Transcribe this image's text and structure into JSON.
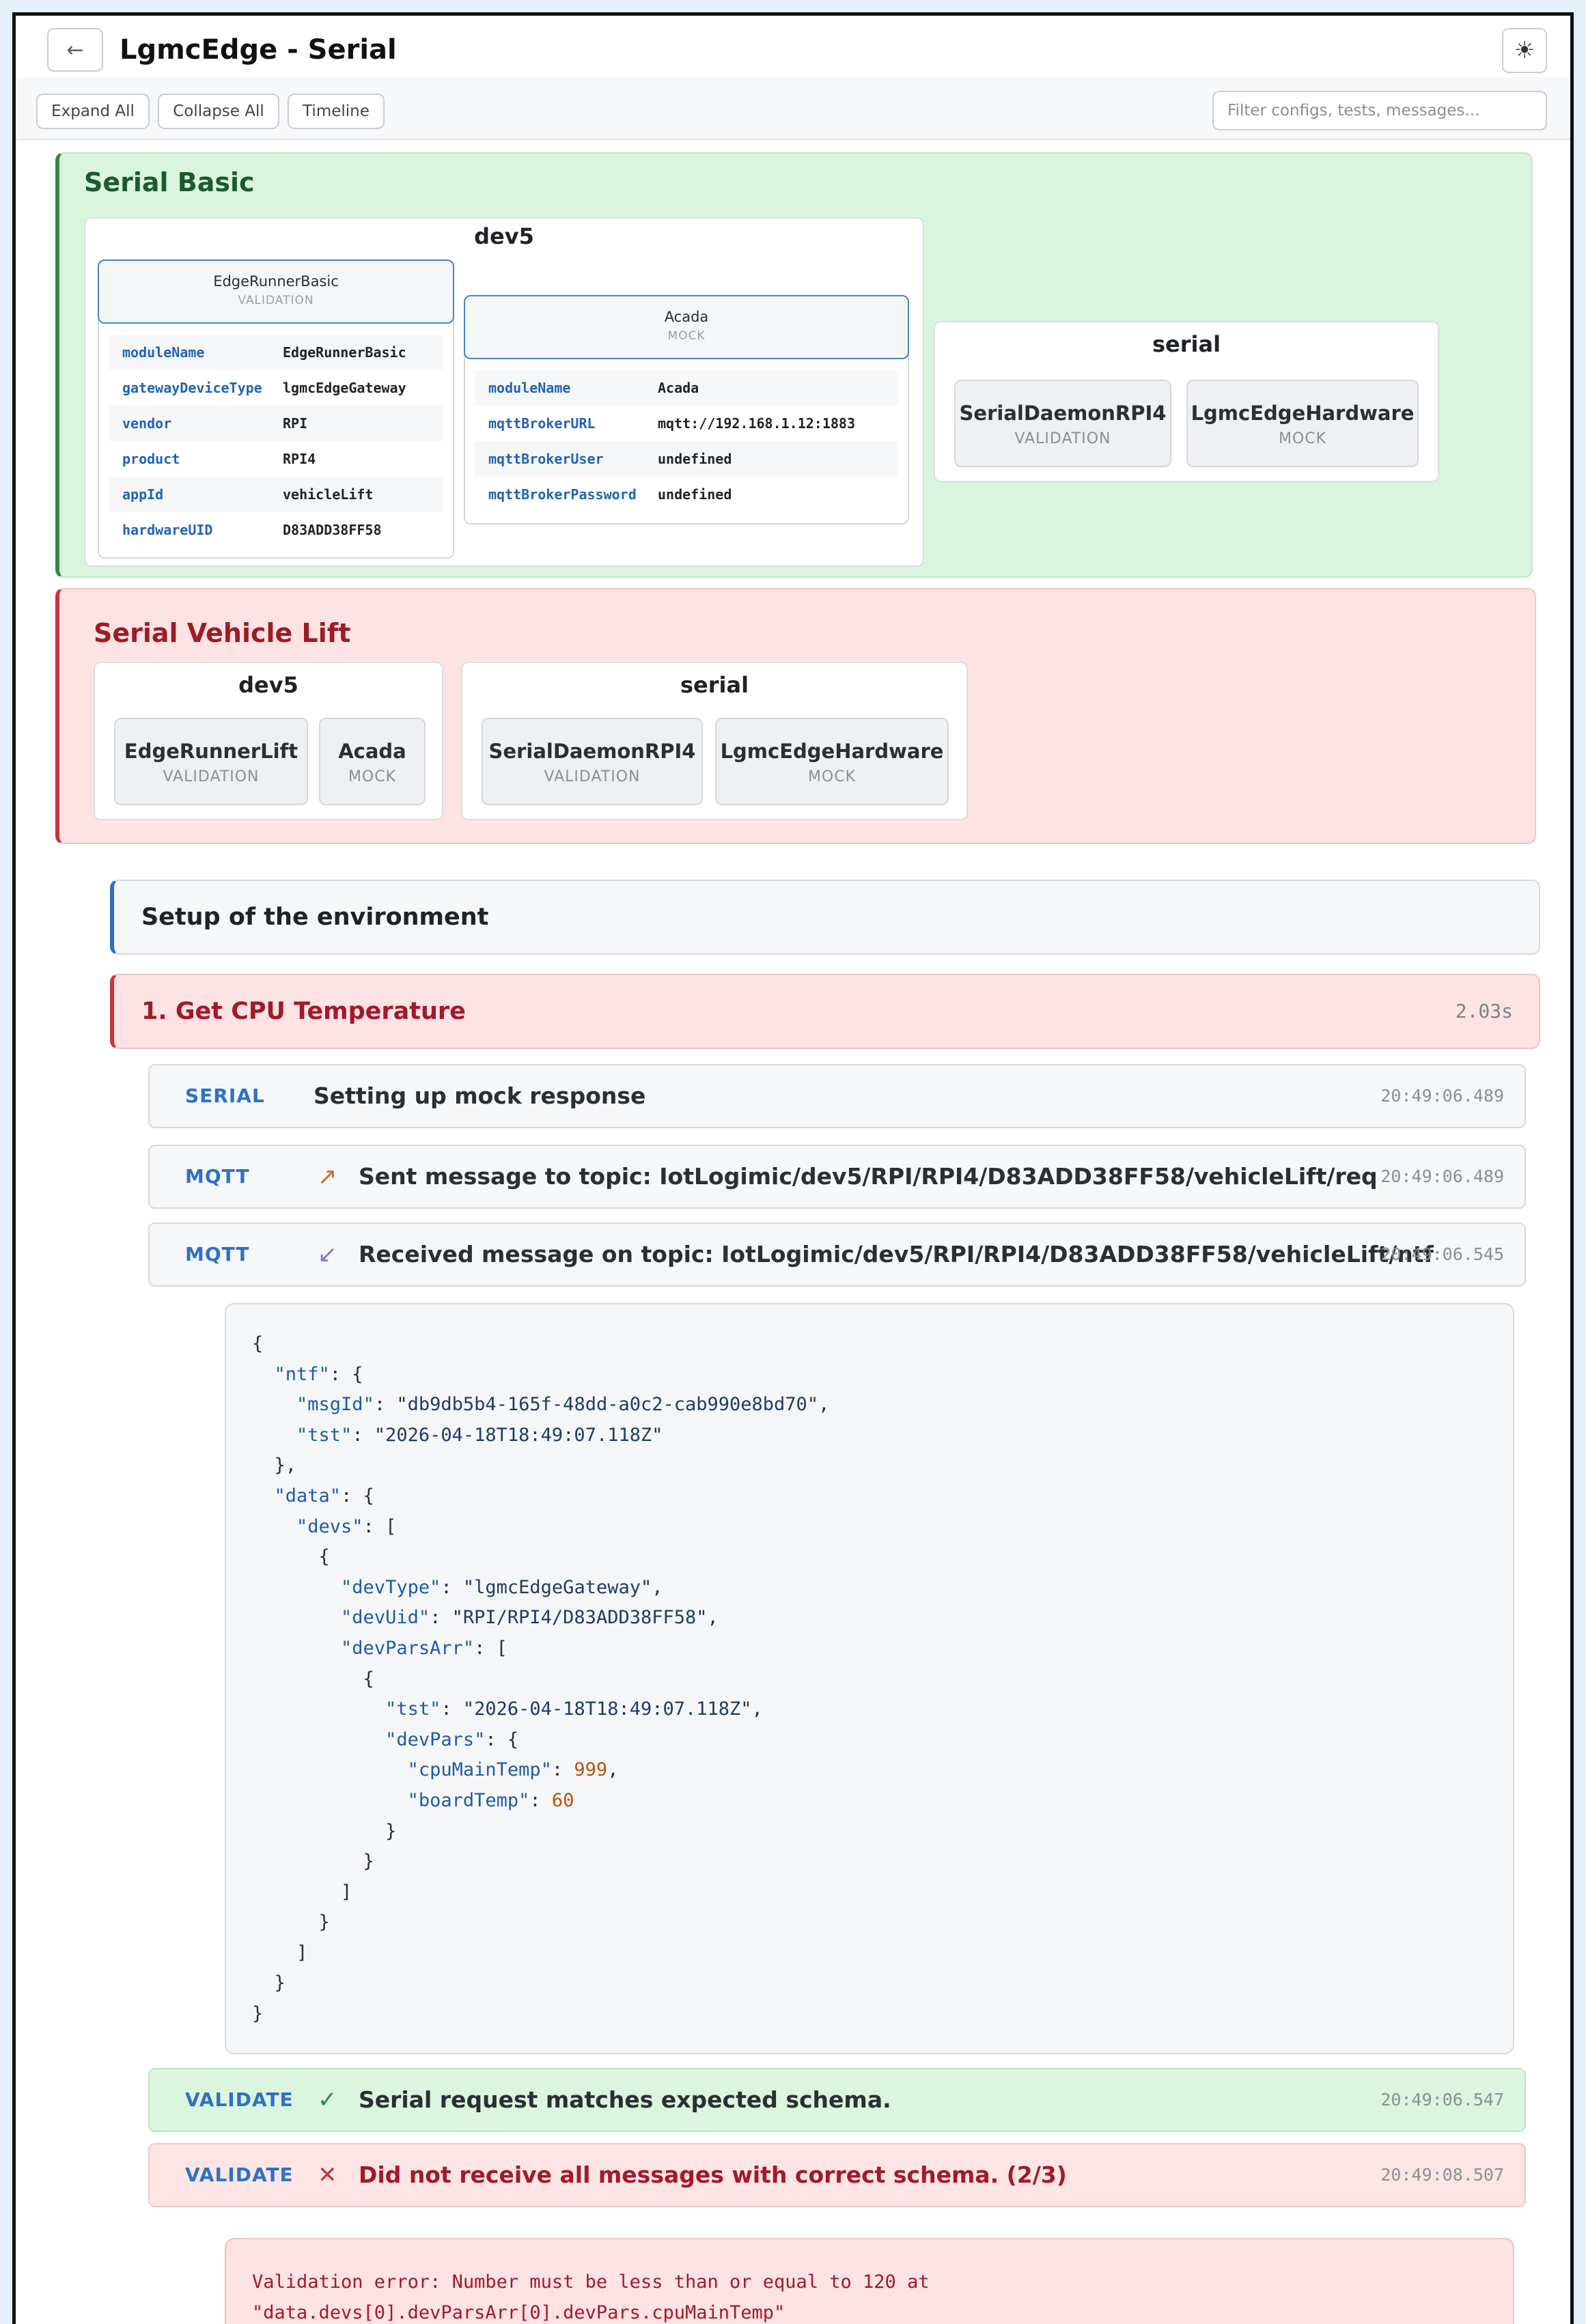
{
  "header": {
    "title": "LgmcEdge - Serial",
    "back_icon": "←",
    "theme_icon": "☀"
  },
  "toolbar": {
    "expand_all": "Expand All",
    "collapse_all": "Collapse All",
    "timeline": "Timeline",
    "filter_placeholder": "Filter configs, tests, messages..."
  },
  "serial_basic": {
    "title": "Serial Basic",
    "dev5": {
      "label": "dev5",
      "configs": [
        {
          "name": "EdgeRunnerBasic",
          "type": "VALIDATION",
          "rows": [
            {
              "key": "moduleName",
              "value": "EdgeRunnerBasic"
            },
            {
              "key": "gatewayDeviceType",
              "value": "lgmcEdgeGateway"
            },
            {
              "key": "vendor",
              "value": "RPI"
            },
            {
              "key": "product",
              "value": "RPI4"
            },
            {
              "key": "appId",
              "value": "vehicleLift"
            },
            {
              "key": "hardwareUID",
              "value": "D83ADD38FF58"
            }
          ]
        },
        {
          "name": "Acada",
          "type": "MOCK",
          "rows": [
            {
              "key": "moduleName",
              "value": "Acada"
            },
            {
              "key": "mqttBrokerURL",
              "value": "mqtt://192.168.1.12:1883"
            },
            {
              "key": "mqttBrokerUser",
              "value": "undefined"
            },
            {
              "key": "mqttBrokerPassword",
              "value": "undefined"
            }
          ]
        }
      ]
    },
    "serial": {
      "label": "serial",
      "modules": [
        {
          "name": "SerialDaemonRPI4",
          "type": "VALIDATION"
        },
        {
          "name": "LgmcEdgeHardware",
          "type": "MOCK"
        }
      ]
    }
  },
  "serial_vehicle_lift": {
    "title": "Serial Vehicle Lift",
    "dev5": {
      "label": "dev5",
      "modules": [
        {
          "name": "EdgeRunnerLift",
          "type": "VALIDATION"
        },
        {
          "name": "Acada",
          "type": "MOCK"
        }
      ]
    },
    "serial": {
      "label": "serial",
      "modules": [
        {
          "name": "SerialDaemonRPI4",
          "type": "VALIDATION"
        },
        {
          "name": "LgmcEdgeHardware",
          "type": "MOCK"
        }
      ]
    }
  },
  "tests": {
    "setup": "Setup of the environment",
    "test1": {
      "title": "1. Get CPU Temperature",
      "duration": "2.03s",
      "steps": [
        {
          "tag": "SERIAL",
          "icon": "",
          "text": "Setting up mock response",
          "time": "20:49:06.489"
        },
        {
          "tag": "MQTT",
          "icon": "↗",
          "text": "Sent message to topic: IotLogimic/dev5/RPI/RPI4/D83ADD38FF58/vehicleLift/req",
          "time": "20:49:06.489"
        },
        {
          "tag": "MQTT",
          "icon": "↙",
          "text": "Received message on topic: IotLogimic/dev5/RPI/RPI4/D83ADD38FF58/vehicleLift/ntf",
          "time": "20:49:06.545"
        },
        {
          "tag": "VALIDATE",
          "icon": "✓",
          "text": "Serial request matches expected schema.",
          "time": "20:49:06.547"
        },
        {
          "tag": "VALIDATE",
          "icon": "✕",
          "text": "Did not receive all messages with correct schema. (2/3)",
          "time": "20:49:08.507"
        }
      ],
      "payload": {
        "msgId": "db9db5b4-165f-48dd-a0c2-cab990e8bd70",
        "ntf_tst": "2026-04-18T18:49:07.118Z",
        "devType": "lgmcEdgeGateway",
        "devUid": "RPI/RPI4/D83ADD38FF58",
        "pars_tst": "2026-04-18T18:49:07.118Z",
        "cpuMainTemp": 999,
        "boardTemp": 60
      },
      "error": "Validation error: Number must be less than or equal to 120 at\n\"data.devs[0].devParsArr[0].devPars.cpuMainTemp\""
    }
  },
  "colors": {
    "green_accent": "#2f8a45",
    "red_accent": "#c8343b",
    "blue_accent": "#2f6fc9",
    "tag_blue": "#2e72c4"
  }
}
